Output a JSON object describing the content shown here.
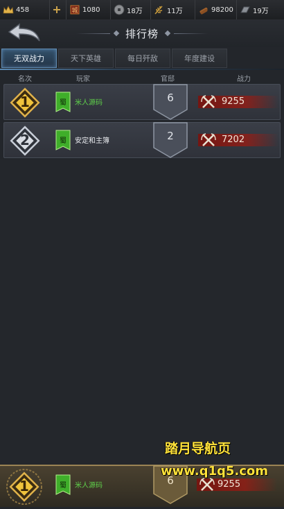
{
  "resources": [
    {
      "icon": "crown-icon",
      "value": "458"
    },
    {
      "icon": "plus-icon",
      "value": ""
    },
    {
      "icon": "city-icon",
      "value": "1080"
    },
    {
      "icon": "coin-icon",
      "value": "18万"
    },
    {
      "icon": "grain-icon",
      "value": "11万"
    },
    {
      "icon": "wood-icon",
      "value": "98200"
    },
    {
      "icon": "iron-icon",
      "value": "19万"
    }
  ],
  "header": {
    "title": "排行榜"
  },
  "tabs": [
    "无双战力",
    "天下英雄",
    "每日歼敌",
    "年度建设"
  ],
  "active_tab": 0,
  "columns": {
    "rank": "名次",
    "player": "玩家",
    "office": "官邸",
    "power": "战力"
  },
  "rows": [
    {
      "rank": "1",
      "faction": "蜀",
      "name": "米人源码",
      "office": "6",
      "power": "9255",
      "name_color": "#5fd04a"
    },
    {
      "rank": "2",
      "faction": "蜀",
      "name": "安定和主簿",
      "office": "2",
      "power": "7202",
      "name_color": "#e8eaee"
    }
  ],
  "self": {
    "rank": "1",
    "faction": "蜀",
    "name": "米人源码",
    "office": "6",
    "power": "9255"
  },
  "watermark": {
    "line1": "踏月导航页",
    "line2": "www.q1q5.com"
  },
  "colors": {
    "accent": "#5f8ab0",
    "faction_green": "#3fae2a",
    "power_red": "#8c1a12"
  }
}
